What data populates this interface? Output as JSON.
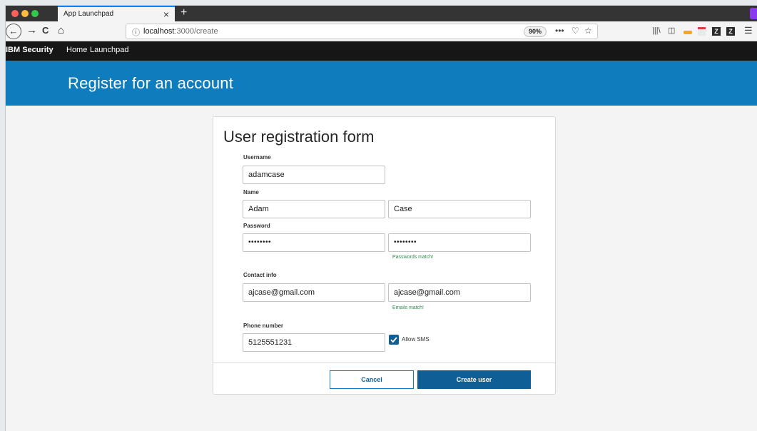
{
  "browser": {
    "tab_title": "App Launchpad",
    "tab_close": "×",
    "new_tab": "+",
    "url_host": "localhost",
    "url_path": ":3000/create",
    "zoom": "90%",
    "icons": [
      "back-icon",
      "forward-icon",
      "reload-icon",
      "home-icon",
      "info-icon",
      "more-icon",
      "pocket-icon",
      "bookmark-star-icon",
      "library-icon",
      "sidebar-icon",
      "pocket-ext-icon",
      "calendar-ext-icon",
      "zotero-icon",
      "zotero-icon-2",
      "menu-icon"
    ],
    "glyphs": {
      "back": "←",
      "forward": "→",
      "reload": "C",
      "home": "⌂",
      "info": "ⓘ",
      "more": "•••",
      "shield": "♡",
      "star": "☆",
      "library": "|||\\",
      "sidebar": "◫",
      "zotero": "Z",
      "menu": "☰"
    }
  },
  "app": {
    "brand": "IBM Security",
    "nav": [
      "Home",
      "Launchpad"
    ],
    "banner_title": "Register for an account"
  },
  "form": {
    "title": "User registration form",
    "username_label": "Username",
    "username": "adamcase",
    "name_label": "Name",
    "first_name": "Adam",
    "last_name": "Case",
    "password_label": "Password",
    "password": "••••••••",
    "password_confirm": "••••••••",
    "password_hint": "Passwords match!",
    "contact_label": "Contact info",
    "email": "ajcase@gmail.com",
    "email_confirm": "ajcase@gmail.com",
    "email_hint": "Emails match!",
    "phone_label": "Phone number",
    "phone": "5125551231",
    "allow_sms_label": "Allow SMS",
    "allow_sms_checked": true,
    "cancel_label": "Cancel",
    "create_label": "Create user"
  },
  "colors": {
    "banner": "#0f7cbd",
    "primary_button": "#0f5f96",
    "success_text": "#2f8a4e",
    "header": "#161616"
  }
}
